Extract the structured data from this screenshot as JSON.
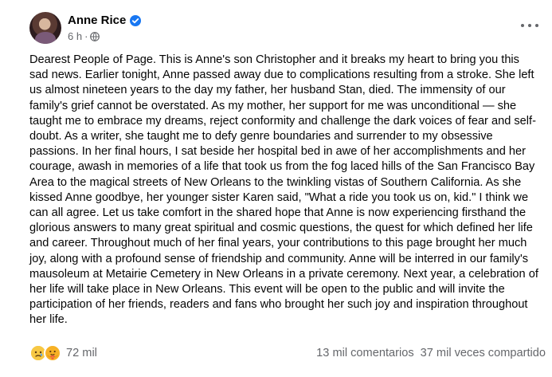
{
  "post": {
    "author": "Anne Rice",
    "time": "6 h",
    "separator": "·",
    "body": "Dearest People of Page. This is Anne's son Christopher and it breaks my heart to bring you this sad news. Earlier tonight, Anne passed away due to complications resulting from a stroke. She left us almost nineteen years to the day my father, her husband Stan, died. The immensity of our family's grief cannot be overstated. As my mother, her support for me was unconditional — she taught me to embrace my dreams, reject conformity and challenge the dark voices of fear and self-doubt. As a writer, she taught me to defy genre boundaries and surrender to my obsessive passions. In her final hours, I sat beside her hospital bed in awe of her accomplishments and her courage, awash in memories of a life that took us from the fog laced hills of the San Francisco Bay Area to the magical streets of New Orleans to the twinkling vistas of Southern California. As she kissed Anne goodbye, her younger sister Karen said, \"What a ride you took us on, kid.\" I think we can all agree. Let us take comfort in the shared hope that Anne is now experiencing firsthand the glorious answers to many great spiritual and cosmic questions, the quest for which defined her life and career.  Throughout much of her final years, your contributions to this page brought her much joy, along with a profound sense of friendship and community. Anne will be interred in our family's mausoleum at Metairie Cemetery in New Orleans in a private ceremony. Next year, a celebration of her life will take place in New Orleans. This event will be open to the public and will invite the participation of her friends, readers and fans who brought her such joy and inspiration throughout her life."
  },
  "stats": {
    "reactions": "72 mil",
    "comments": "13 mil comentarios",
    "shares": "37 mil veces compartido"
  },
  "icons": {
    "verified": "verified-badge-icon",
    "audience": "globe-icon",
    "menu": "more-options-icon",
    "reactions": [
      "sad-reaction-icon",
      "care-reaction-icon"
    ]
  },
  "colors": {
    "verified": "#1877f2",
    "secondary_text": "#65676b",
    "primary_text": "#050505"
  }
}
